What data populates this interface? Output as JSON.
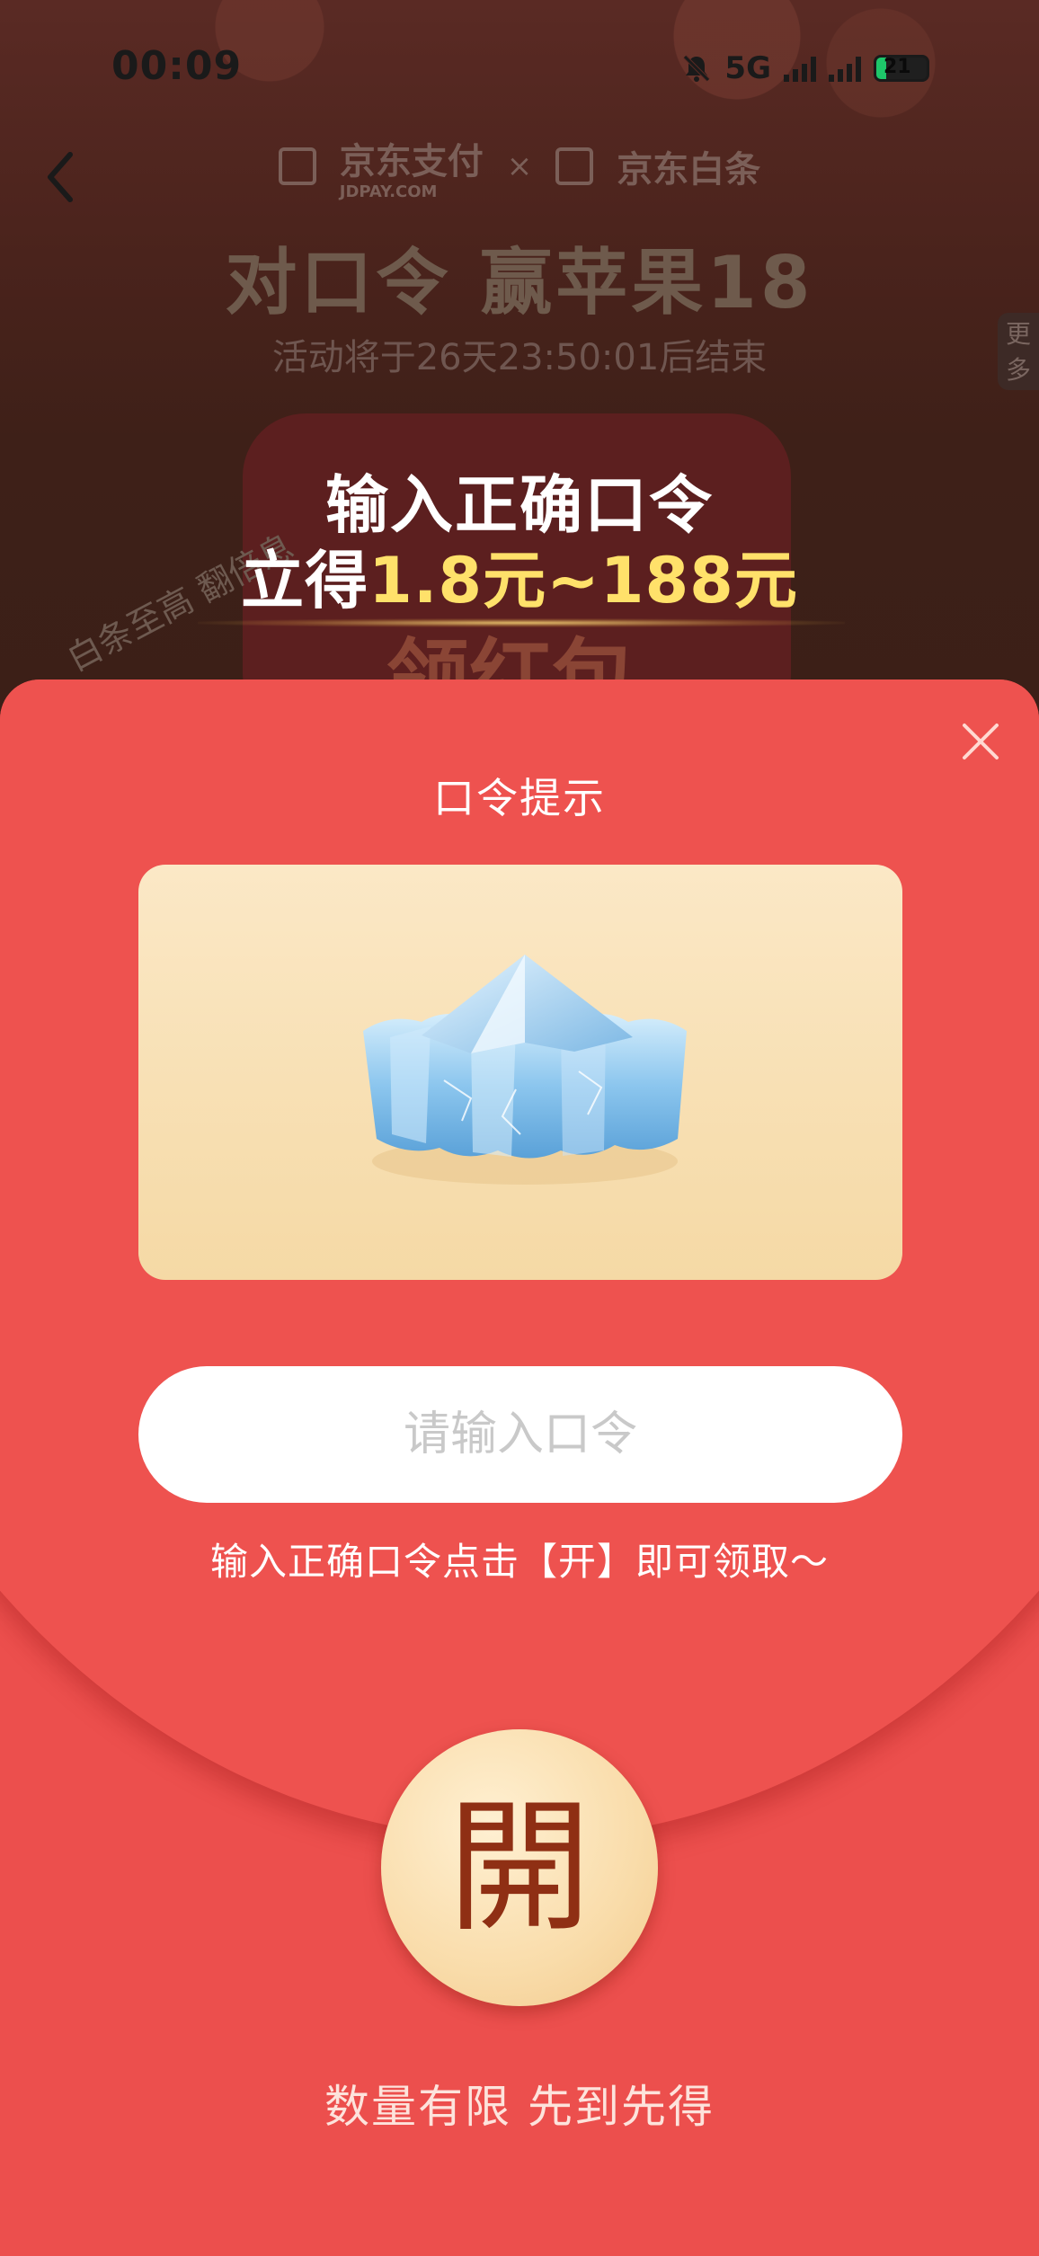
{
  "status_bar": {
    "time": "00:09",
    "network": "5G",
    "battery_level": "21"
  },
  "header": {
    "brand_left": "京东支付",
    "brand_left_sub": "JDPAY.COM",
    "brand_separator": "×",
    "brand_right": "京东白条"
  },
  "background": {
    "title": "对口令 赢苹果18",
    "countdown": "活动将于26天23:50:01后结束",
    "more_tab": "更多",
    "handwriting": "白条至高 翻倍息",
    "card_ghost_text": "领红包"
  },
  "promo": {
    "line1": "输入正确口令",
    "line2_prefix": "立得",
    "line2_amount": "1.8元~188元"
  },
  "modal": {
    "title": "口令提示",
    "hint_image": "blue-crystal-icon",
    "input_placeholder": "请输入口令",
    "input_value": "",
    "input_note": "输入正确口令点击【开】即可领取～",
    "open_label": "開",
    "footer_note": "数量有限 先到先得"
  },
  "colors": {
    "modal_red": "#ec4f4d",
    "open_button": "#f9dcaa",
    "open_text": "#8f2f14",
    "promo_amount": "#ffe16a"
  }
}
